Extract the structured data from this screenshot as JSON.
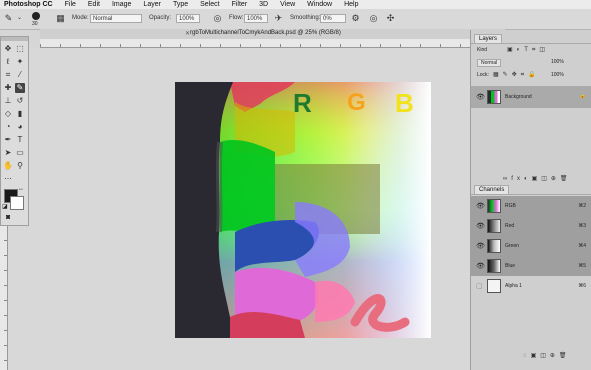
{
  "menubar": {
    "app_name": "Photoshop CC",
    "items": [
      "File",
      "Edit",
      "Image",
      "Layer",
      "Type",
      "Select",
      "Filter",
      "3D",
      "View",
      "Window",
      "Help"
    ]
  },
  "options": {
    "brush_size": "30",
    "mode_label": "Mode:",
    "mode_value": "Normal",
    "opacity_label": "Opacity:",
    "opacity_value": "100%",
    "flow_label": "Flow:",
    "flow_value": "100%",
    "smoothing_label": "Smoothing:",
    "smoothing_value": "0%"
  },
  "document": {
    "title": "rgbToMultichannelToCmykAndBack.psd @ 25% (RGB/8)"
  },
  "canvas": {
    "letters": [
      "R",
      "G",
      "B"
    ],
    "letter_colors": [
      "#1f7a2e",
      "#f7a21b",
      "#f2e21b"
    ],
    "colors": {
      "dark": "#2a2830",
      "green": "#00c41d",
      "blue": "#2b4fb0",
      "magenta": "#e069d8",
      "red": "#d43d5c",
      "ampersand": "#e86d7e"
    }
  },
  "layers_panel": {
    "title": "Layers",
    "kind_label": "Kind",
    "mode_value": "Normal",
    "opacity_value": "100%",
    "lock_label": "Lock:",
    "fill_value": "100%",
    "layers": [
      {
        "name": "Background"
      }
    ]
  },
  "channels_panel": {
    "title": "Channels",
    "channels": [
      {
        "name": "RGB",
        "key": "⌘2"
      },
      {
        "name": "Red",
        "key": "⌘3"
      },
      {
        "name": "Green",
        "key": "⌘4"
      },
      {
        "name": "Blue",
        "key": "⌘5"
      },
      {
        "name": "Alpha 1",
        "key": "⌘6"
      }
    ]
  }
}
